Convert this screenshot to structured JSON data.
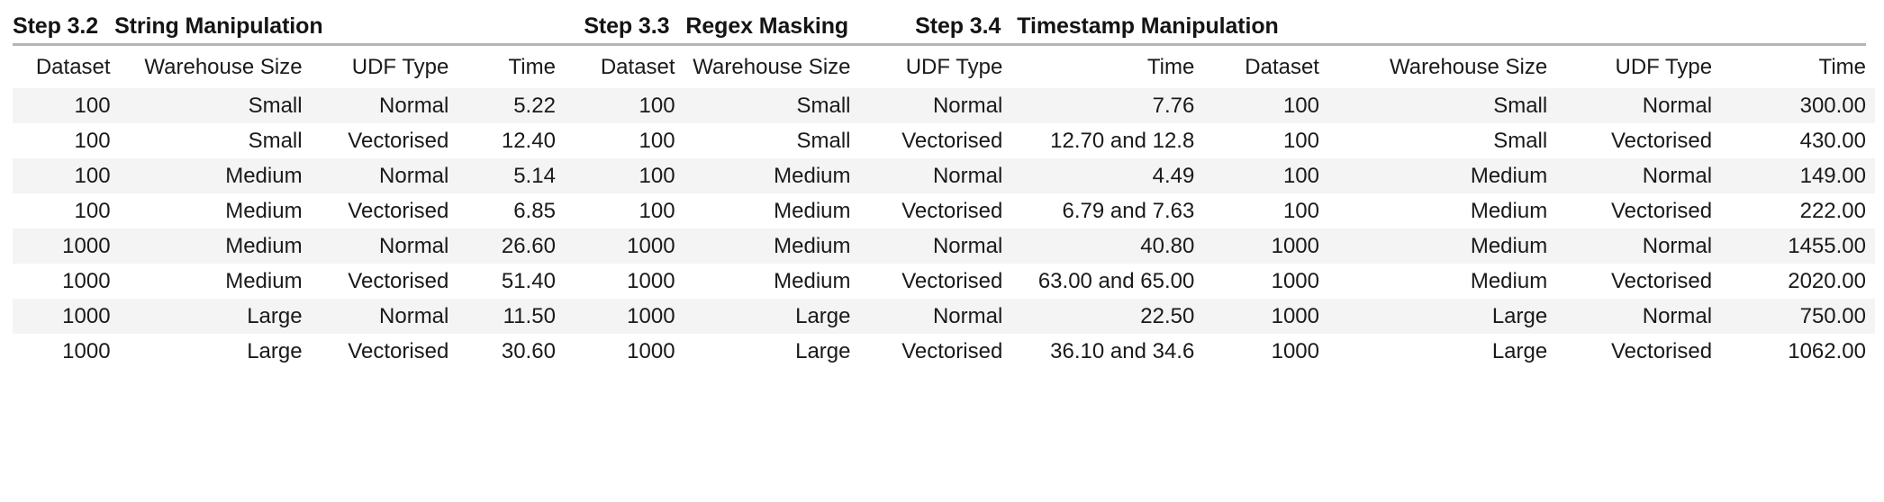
{
  "sections": [
    {
      "step": "Step 3.2",
      "title": "String Manipulation",
      "columns": [
        "Dataset",
        "Warehouse Size",
        "UDF Type",
        "Time"
      ],
      "rows": [
        [
          "100",
          "Small",
          "Normal",
          "5.22"
        ],
        [
          "100",
          "Small",
          "Vectorised",
          "12.40"
        ],
        [
          "100",
          "Medium",
          "Normal",
          "5.14"
        ],
        [
          "100",
          "Medium",
          "Vectorised",
          "6.85"
        ],
        [
          "1000",
          "Medium",
          "Normal",
          "26.60"
        ],
        [
          "1000",
          "Medium",
          "Vectorised",
          "51.40"
        ],
        [
          "1000",
          "Large",
          "Normal",
          "11.50"
        ],
        [
          "1000",
          "Large",
          "Vectorised",
          "30.60"
        ]
      ]
    },
    {
      "step": "Step 3.3",
      "title": "Regex Masking",
      "columns": [
        "Dataset",
        "Warehouse Size",
        "UDF Type",
        "Time"
      ],
      "rows": [
        [
          "100",
          "Small",
          "Normal",
          "7.76"
        ],
        [
          "100",
          "Small",
          "Vectorised",
          "12.70 and 12.8"
        ],
        [
          "100",
          "Medium",
          "Normal",
          "4.49"
        ],
        [
          "100",
          "Medium",
          "Vectorised",
          "6.79 and 7.63"
        ],
        [
          "1000",
          "Medium",
          "Normal",
          "40.80"
        ],
        [
          "1000",
          "Medium",
          "Vectorised",
          "63.00 and 65.00"
        ],
        [
          "1000",
          "Large",
          "Normal",
          "22.50"
        ],
        [
          "1000",
          "Large",
          "Vectorised",
          "36.10 and 34.6"
        ]
      ]
    },
    {
      "step": "Step 3.4",
      "title": "Timestamp Manipulation",
      "columns": [
        "Dataset",
        "Warehouse Size",
        "UDF Type",
        "Time"
      ],
      "rows": [
        [
          "100",
          "Small",
          "Normal",
          "300.00"
        ],
        [
          "100",
          "Small",
          "Vectorised",
          "430.00"
        ],
        [
          "100",
          "Medium",
          "Normal",
          "149.00"
        ],
        [
          "100",
          "Medium",
          "Vectorised",
          "222.00"
        ],
        [
          "1000",
          "Medium",
          "Normal",
          "1455.00"
        ],
        [
          "1000",
          "Medium",
          "Vectorised",
          "2020.00"
        ],
        [
          "1000",
          "Large",
          "Normal",
          "750.00"
        ],
        [
          "1000",
          "Large",
          "Vectorised",
          "1062.00"
        ]
      ]
    }
  ],
  "style": {
    "row_stripe_color": "#f4f4f4",
    "row_base_color": "#ffffff",
    "rule_color": "#b5b5b5",
    "text_color": "#1a1a1a"
  }
}
